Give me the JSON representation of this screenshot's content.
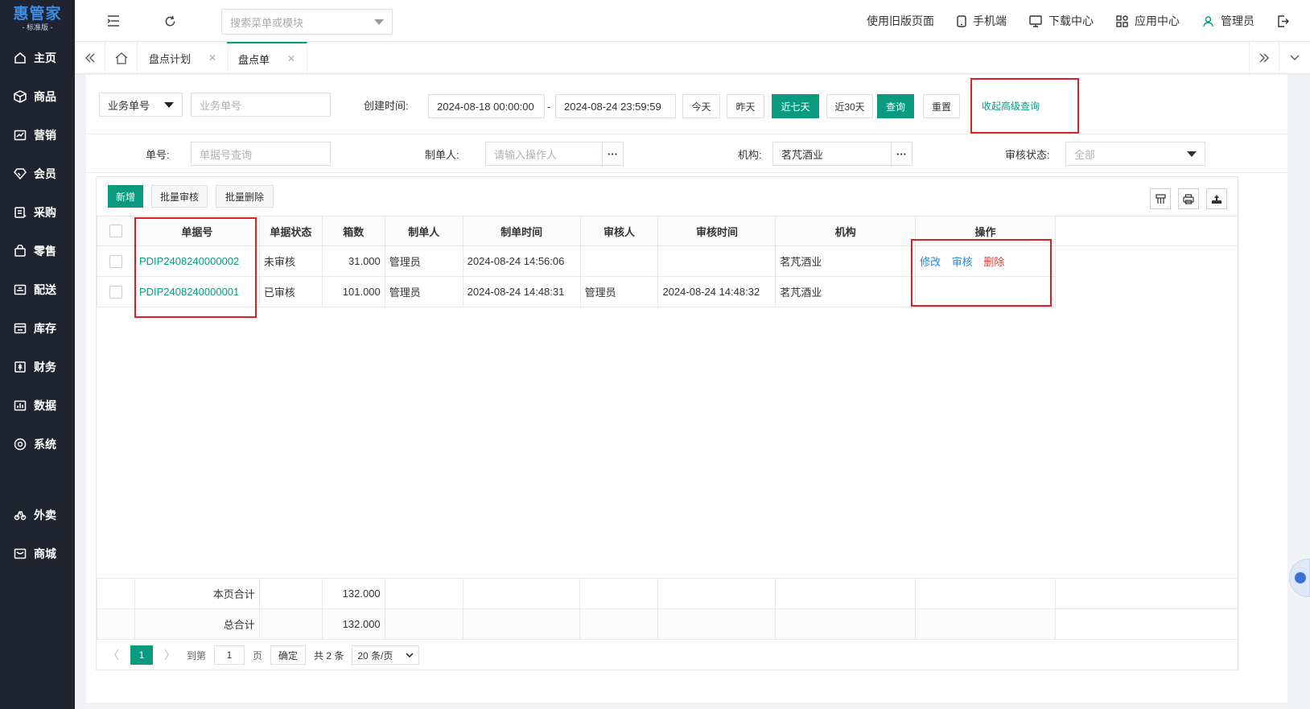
{
  "app": {
    "logo_main": "惠管家",
    "logo_sub": "- 标准版 -"
  },
  "sidebar": {
    "items": [
      {
        "label": "主页",
        "icon": "home-icon"
      },
      {
        "label": "商品",
        "icon": "box-icon"
      },
      {
        "label": "营销",
        "icon": "trend-icon"
      },
      {
        "label": "会员",
        "icon": "diamond-icon"
      },
      {
        "label": "采购",
        "icon": "purchase-icon"
      },
      {
        "label": "零售",
        "icon": "bag-icon"
      },
      {
        "label": "配送",
        "icon": "delivery-icon"
      },
      {
        "label": "库存",
        "icon": "storage-icon"
      },
      {
        "label": "财务",
        "icon": "finance-icon"
      },
      {
        "label": "数据",
        "icon": "chart-icon"
      },
      {
        "label": "系统",
        "icon": "system-icon"
      }
    ],
    "extra_items": [
      {
        "label": "外卖",
        "icon": "takeout-icon"
      },
      {
        "label": "商城",
        "icon": "mall-icon"
      }
    ]
  },
  "header": {
    "search_placeholder": "搜索菜单或模块",
    "links": {
      "old_page": "使用旧版页面",
      "mobile": "手机端",
      "download": "下载中心",
      "apps": "应用中心",
      "user": "管理员"
    }
  },
  "tabs": [
    {
      "label": "盘点计划",
      "active": false
    },
    {
      "label": "盘点单",
      "active": true
    }
  ],
  "filters": {
    "business_type": "业务单号",
    "business_no_placeholder": "业务单号",
    "created_label": "创建时间:",
    "date_from": "2024-08-18 00:00:00",
    "date_sep": "-",
    "date_to": "2024-08-24 23:59:59",
    "quick": {
      "today": "今天",
      "yesterday": "昨天",
      "last7": "近七天",
      "last30": "近30天"
    },
    "query_button": "查询",
    "reset_button": "重置",
    "collapse_link": "收起高级查询",
    "doc_no_label": "单号:",
    "doc_no_placeholder": "单据号查询",
    "creator_label": "制单人:",
    "creator_placeholder": "请输入操作人",
    "org_label": "机构:",
    "org_value": "茗芃酒业",
    "audit_label": "审核状态:",
    "audit_value": "全部",
    "dots": "···"
  },
  "toolbar": {
    "add": "新增",
    "batch_audit": "批量审核",
    "batch_delete": "批量删除"
  },
  "table": {
    "headers": {
      "doc_no": "单据号",
      "status": "单据状态",
      "boxes": "箱数",
      "creator": "制单人",
      "created_at": "制单时间",
      "auditor": "审核人",
      "audited_at": "审核时间",
      "org": "机构",
      "ops": "操作"
    },
    "rows": [
      {
        "doc_no": "PDIP2408240000002",
        "status": "未审核",
        "boxes": "31.000",
        "creator": "管理员",
        "created_at": "2024-08-24 14:56:06",
        "auditor": "",
        "audited_at": "",
        "org": "茗芃酒业"
      },
      {
        "doc_no": "PDIP2408240000001",
        "status": "已审核",
        "boxes": "101.000",
        "creator": "管理员",
        "created_at": "2024-08-24 14:48:31",
        "auditor": "管理员",
        "audited_at": "2024-08-24 14:48:32",
        "org": "茗芃酒业"
      }
    ],
    "ops": {
      "edit": "修改",
      "audit": "审核",
      "delete": "删除"
    }
  },
  "summary": {
    "page_total_label": "本页合计",
    "page_total": "132.000",
    "grand_total_label": "总合计",
    "grand_total": "132.000"
  },
  "pager": {
    "current": "1",
    "goto_label": "到第",
    "goto_value": "1",
    "page_unit": "页",
    "confirm": "确定",
    "total": "共 2 条",
    "page_size": "20 条/页"
  },
  "colors": {
    "accent": "#0a9a80",
    "sidebar": "#1f2430",
    "highlight": "#e02020",
    "link": "#1e88e5",
    "danger": "#e53935"
  }
}
